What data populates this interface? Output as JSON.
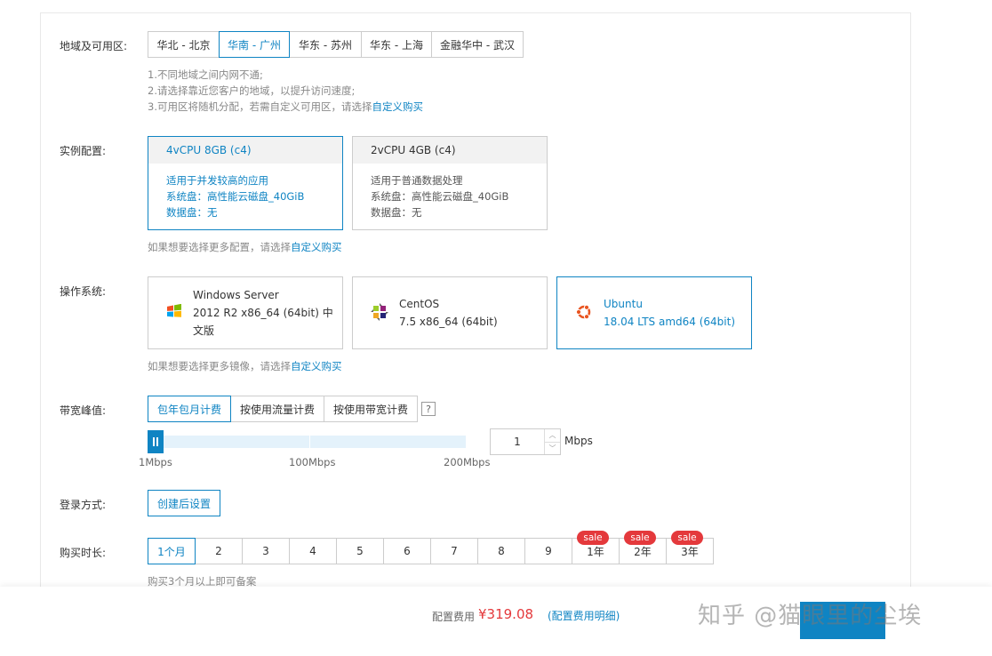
{
  "region": {
    "label": "地域及可用区:",
    "options": [
      "华北 - 北京",
      "华南 - 广州",
      "华东 - 苏州",
      "华东 - 上海",
      "金融华中 - 武汉"
    ],
    "selected": "华南 - 广州",
    "hints": [
      "1.不同地域之间内网不通;",
      "2.请选择靠近您客户的地域，以提升访问速度;",
      "3.可用区将随机分配，若需自定义可用区，请选择"
    ],
    "hint_link": "自定义购买"
  },
  "instance": {
    "label": "实例配置:",
    "cards": [
      {
        "title": "4vCPU 8GB (c4)",
        "lines": [
          "适用于并发较高的应用",
          "系统盘：高性能云磁盘_40GiB",
          "数据盘：无"
        ]
      },
      {
        "title": "2vCPU 4GB (c4)",
        "lines": [
          "适用于普通数据处理",
          "系统盘：高性能云磁盘_40GiB",
          "数据盘：无"
        ]
      }
    ],
    "hint": "如果想要选择更多配置，请选择",
    "hint_link": "自定义购买"
  },
  "os": {
    "label": "操作系统:",
    "options": [
      {
        "icon": "windows-icon",
        "lines": [
          "Windows Server",
          "2012 R2 x86_64 (64bit) 中",
          "文版"
        ]
      },
      {
        "icon": "centos-icon",
        "lines": [
          "CentOS",
          "7.5 x86_64 (64bit)"
        ]
      },
      {
        "icon": "ubuntu-icon",
        "lines": [
          "Ubuntu",
          "18.04 LTS amd64 (64bit)"
        ]
      }
    ],
    "hint": "如果想要选择更多镜像，请选择",
    "hint_link": "自定义购买"
  },
  "bandwidth": {
    "label": "带宽峰值:",
    "billing": [
      "包年包月计费",
      "按使用流量计费",
      "按使用带宽计费"
    ],
    "help": "?",
    "ticks": [
      "1Mbps",
      "100Mbps",
      "200Mbps"
    ],
    "value": "1",
    "unit": "Mbps",
    "slider_fraction": 0.005
  },
  "login": {
    "label": "登录方式:",
    "button": "创建后设置"
  },
  "duration": {
    "label": "购买时长:",
    "options": [
      "1个月",
      "2",
      "3",
      "4",
      "5",
      "6",
      "7",
      "8",
      "9",
      "1年",
      "2年",
      "3年"
    ],
    "sale_badge": "sale",
    "hint": "购买3个月以上即可备案"
  },
  "footer": {
    "price_label": "配置费用",
    "price": "¥319.08",
    "detail": "(配置费用明细)"
  },
  "watermark": "知乎 @猫眼里的尘埃",
  "colors": {
    "accent": "#0f84c3",
    "sale": "#e4393c"
  }
}
